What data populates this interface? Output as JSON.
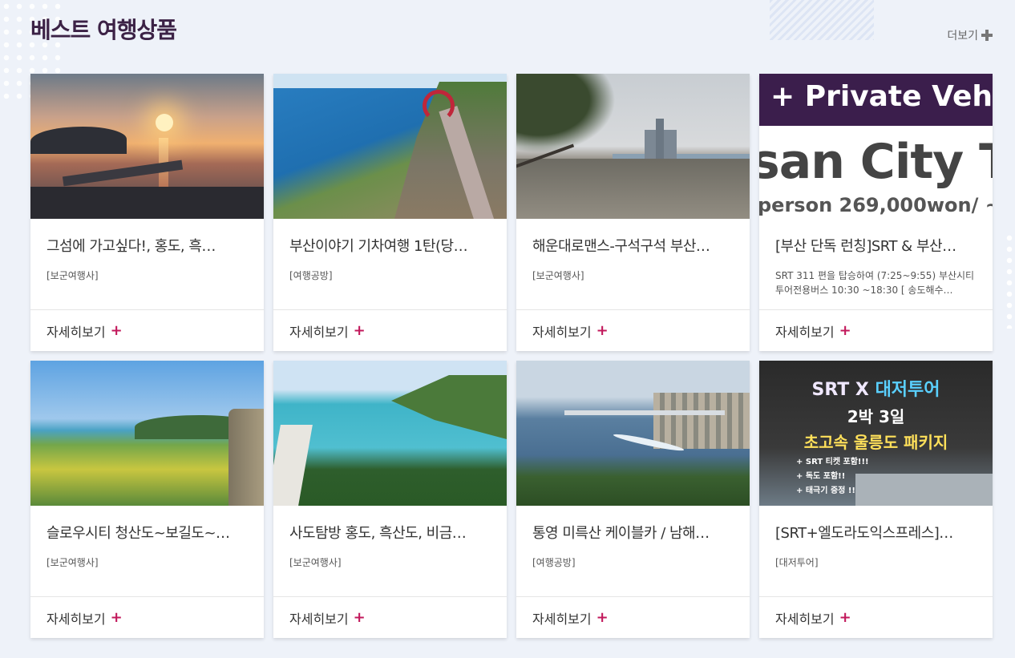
{
  "header": {
    "title": "베스트 여행상품",
    "more_label": "더보기"
  },
  "cards": [
    {
      "title": "그섬에 가고싶다!, 홍도, 흑…",
      "desc": "[보군여행사]",
      "detail_label": "자세히보기",
      "thumb": "sunset-island"
    },
    {
      "title": "부산이야기 기차여행 1탄(당…",
      "desc": "[여행공방]",
      "detail_label": "자세히보기",
      "thumb": "coastal-walkway"
    },
    {
      "title": "해운대로맨스-구석구석 부산…",
      "desc": "[보군여행사]",
      "detail_label": "자세히보기",
      "thumb": "rocky-beach-city"
    },
    {
      "title": "[부산 단독 런칭]SRT & 부산…",
      "desc": "SRT 311 편을 탑승하여 (7:25~9:55) 부산시티투어전용버스 10:30 ~18:30 [ 송도해수…",
      "detail_label": "자세히보기",
      "thumb": "busan-city-tour-poster",
      "poster_lines": [
        "+ Private Veh",
        "san City To",
        "person 269,000won/ ~7"
      ]
    },
    {
      "title": "슬로우시티 청산도~보길도~…",
      "desc": "[보군여행사]",
      "detail_label": "자세히보기",
      "thumb": "island-village-fields"
    },
    {
      "title": "사도탐방 홍도, 흑산도, 비금…",
      "desc": "[보군여행사]",
      "detail_label": "자세히보기",
      "thumb": "turquoise-bay"
    },
    {
      "title": "통영 미륵산 케이블카 / 남해…",
      "desc": "[여행공방]",
      "detail_label": "자세히보기",
      "thumb": "harbor-bridge"
    },
    {
      "title": "[SRT+엘도라도익스프레스]…",
      "desc": "[대저투어]",
      "detail_label": "자세히보기",
      "thumb": "ulleungdo-package-poster",
      "poster_lines": {
        "line1_a": "SRT X ",
        "line1_b": "대저투어",
        "line2": "2박 3일",
        "line3": "초고속 울릉도 패키지",
        "bullets": [
          "+ SRT 티켓 포함!!!",
          "+ 독도 포함!!",
          "+ 태극기 증정 !!"
        ]
      }
    }
  ],
  "colors": {
    "background": "#eef2f9",
    "title": "#3c2246",
    "accent_plus": "#c2185b"
  }
}
